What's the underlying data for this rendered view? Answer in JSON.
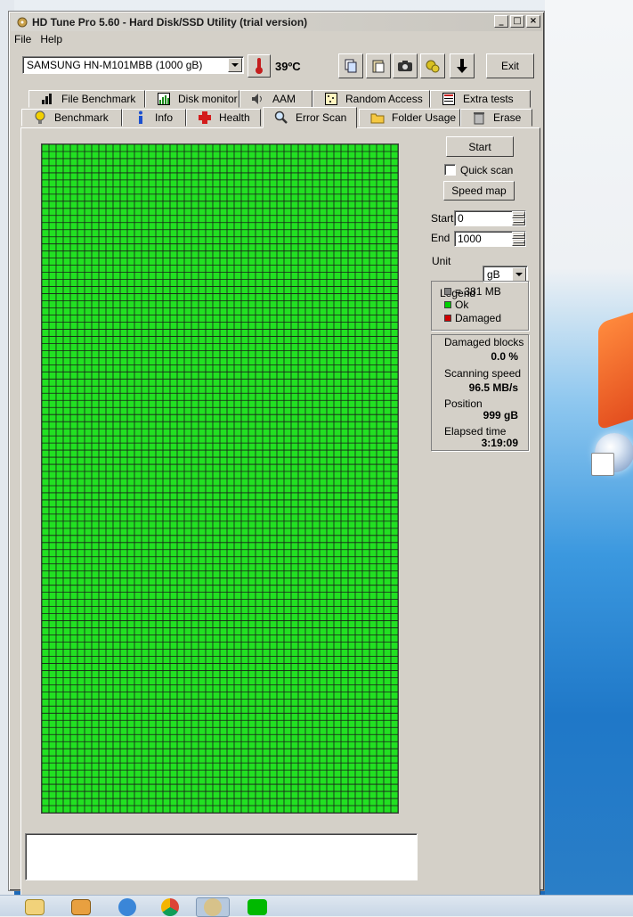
{
  "window": {
    "title": "HD Tune Pro 5.60 - Hard Disk/SSD Utility (trial version)",
    "controls": [
      "_",
      "□",
      "×"
    ]
  },
  "menu": {
    "file": "File",
    "help": "Help"
  },
  "toolbar": {
    "drive": "SAMSUNG HN-M101MBB (1000 gB)",
    "temperature": "39ºC",
    "exit_label": "Exit"
  },
  "tabs": {
    "row1": [
      "File Benchmark",
      "Disk monitor",
      "AAM",
      "Random Access",
      "Extra tests"
    ],
    "row2": [
      "Benchmark",
      "Info",
      "Health",
      "Error Scan",
      "Folder Usage",
      "Erase"
    ],
    "active": "Error Scan"
  },
  "controls": {
    "start_button": "Start",
    "quick_scan_label": "Quick scan",
    "quick_scan_checked": false,
    "speed_map_button": "Speed map",
    "start_label": "Start",
    "start_value": "0",
    "end_label": "End",
    "end_value": "1000",
    "unit_label": "Unit",
    "unit_value": "gB"
  },
  "legend": {
    "title": "Legend",
    "items": [
      {
        "label": "= 381 MB",
        "color": "#808080"
      },
      {
        "label": "Ok",
        "color": "#00d000"
      },
      {
        "label": "Damaged",
        "color": "#d00000"
      }
    ]
  },
  "stats": {
    "damaged_blocks_label": "Damaged blocks",
    "damaged_blocks_value": "0.0 %",
    "scanning_speed_label": "Scanning speed",
    "scanning_speed_value": "96.5 MB/s",
    "position_label": "Position",
    "position_value": "999 gB",
    "elapsed_label": "Elapsed time",
    "elapsed_value": "3:19:09"
  },
  "scan_map": {
    "ok_color": "#22e022",
    "border_color": "#1a1a1a",
    "damaged_count": 0
  },
  "taskbar": {
    "icons": [
      "explorer-icon",
      "media-player-icon",
      "internet-explorer-icon",
      "chrome-icon",
      "hdtune-icon",
      "line-icon"
    ]
  }
}
